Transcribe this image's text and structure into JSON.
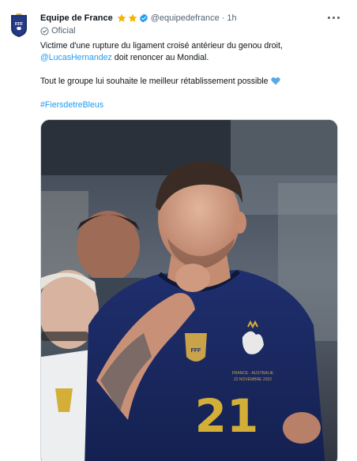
{
  "tweet": {
    "author_name": "Equipe de France",
    "handle": "@equipedefrance",
    "separator": "·",
    "time": "1h",
    "badge_label": "Oficial",
    "text_line1": "Victime d'une rupture du ligament croisé antérieur du genou droit,",
    "mention": "@LucasHernandez",
    "text_line2_rest": " doit renoncer au Mondial.",
    "text_line3": "Tout le groupe lui souhaite le meilleur rétablissement possible",
    "hashtag": "#FiersdetreBleus"
  },
  "icons": {
    "avatar": "fff-crest-logo",
    "stars": [
      "gold-star-icon",
      "gold-star-icon"
    ],
    "verified": "verified-badge-icon",
    "more": "more-dots-icon",
    "official": "official-check-icon",
    "heart": "blue-heart-emoji"
  },
  "colors": {
    "link": "#1d9bf0",
    "secondary_text": "#536471",
    "star": "#f5b400",
    "verified": "#1d9bf0",
    "heart": "#5aa9e6"
  },
  "media": {
    "jersey_number": "21",
    "jersey_patch_text": "FRANCE - AUSTRALIE",
    "jersey_date_text": "22 NOVEMBRE 2022",
    "crest_text": "FFF"
  }
}
